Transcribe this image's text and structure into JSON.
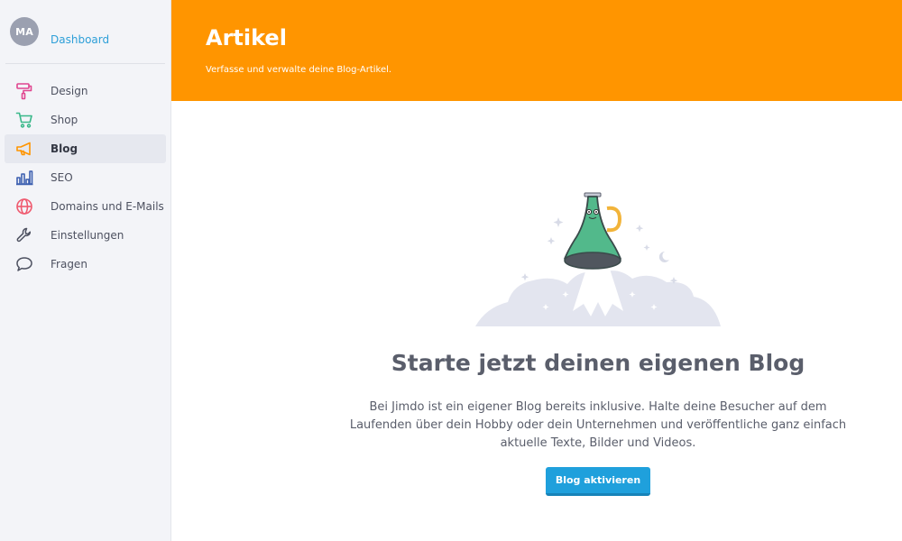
{
  "sidebar": {
    "avatar_initials": "MA",
    "dashboard_label": "Dashboard",
    "items": [
      {
        "label": "Design",
        "icon": "paint-roller-icon",
        "color": "#e0458f"
      },
      {
        "label": "Shop",
        "icon": "shopping-cart-icon",
        "color": "#3ab88a"
      },
      {
        "label": "Blog",
        "icon": "megaphone-icon",
        "color": "#ff9500",
        "active": true
      },
      {
        "label": "SEO",
        "icon": "bar-chart-icon",
        "color": "#3c5fb0"
      },
      {
        "label": "Domains und E-Mails",
        "icon": "globe-icon",
        "color": "#ef5a6f"
      },
      {
        "label": "Einstellungen",
        "icon": "wrench-icon",
        "color": "#4d5160"
      },
      {
        "label": "Fragen",
        "icon": "speech-bubble-icon",
        "color": "#4d5160"
      }
    ]
  },
  "header": {
    "title": "Artikel",
    "subtitle": "Verfasse und verwalte deine Blog-Artikel.",
    "color": "#ff9500"
  },
  "main": {
    "title": "Starte jetzt deinen eigenen Blog",
    "text": "Bei Jimdo ist ein eigener Blog bereits inklusive. Halte deine Besucher auf dem Laufenden über dein Hobby oder dein Unternehmen und veröffentliche ganz einfach aktuelle Texte, Bilder und Videos.",
    "button_label": "Blog aktivieren",
    "button_color": "#1fa0dc"
  }
}
